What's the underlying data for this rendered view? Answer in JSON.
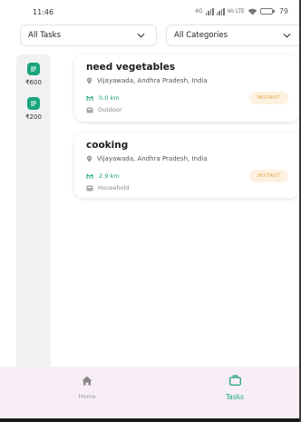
{
  "status_bar": {
    "time": "11:46",
    "network_text": "4G",
    "volte_text": "Vo LTE",
    "battery_percent": "79"
  },
  "filters": {
    "tasks": {
      "label": "All Tasks",
      "icon": "chevron-down-icon"
    },
    "categories": {
      "label": "All Categories",
      "icon": "chevron-down-icon"
    }
  },
  "sidebar": {
    "items": [
      {
        "amount": "₹600",
        "icon": "task-icon"
      },
      {
        "amount": "₹200",
        "icon": "task-icon"
      }
    ]
  },
  "tasks": [
    {
      "title": "need vegetables",
      "location": "Vijayawada, Andhra Pradesh, India",
      "distance": "0.0 km",
      "category": "Outdoor",
      "badge": "INSTANT"
    },
    {
      "title": "cooking",
      "location": "Vijayawada, Andhra Pradesh, India",
      "distance": "2.9 km",
      "category": "Household",
      "badge": "INSTANT"
    }
  ],
  "bottom_nav": {
    "home": {
      "label": "Home",
      "icon": "home-icon"
    },
    "tasks": {
      "label": "Tasks",
      "icon": "briefcase-icon"
    }
  },
  "colors": {
    "accent": "#1aa57a",
    "badge_bg": "#fdf1df",
    "badge_text": "#e8a74a",
    "nav_bg": "#f8eef6"
  }
}
